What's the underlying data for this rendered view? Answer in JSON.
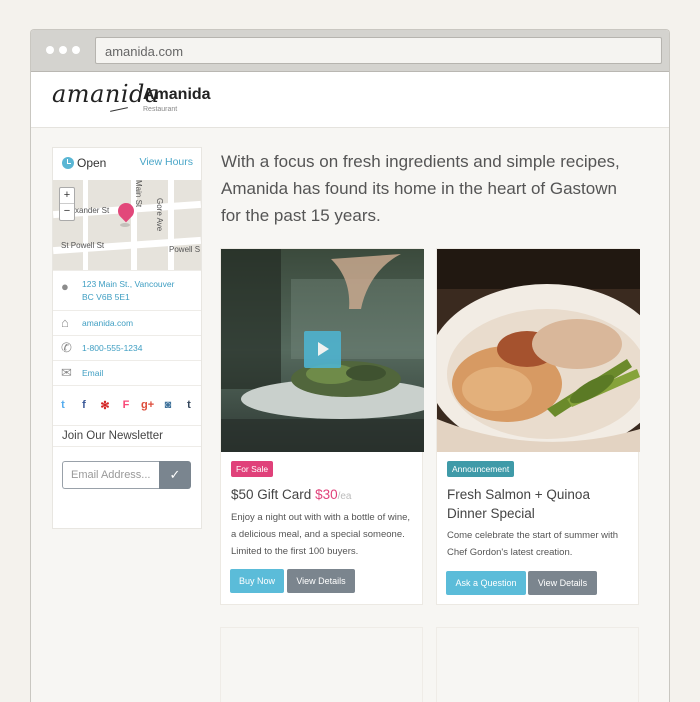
{
  "browser": {
    "url": "amanida.com"
  },
  "header": {
    "logo_text": "amanida",
    "name": "Amanida",
    "subtitle": "Restaurant"
  },
  "sidebar": {
    "status": "Open",
    "view_hours": "View Hours",
    "map": {
      "streets": [
        "xander St",
        "St Powell St",
        "Powell S",
        "Gore Ave",
        "Main St"
      ],
      "zoom_in": "+",
      "zoom_out": "−"
    },
    "address_line1": "123 Main St., Vancouver",
    "address_line2": "BC V6B 5E1",
    "website": "amanida.com",
    "phone": "1-800-555-1234",
    "email": "Email",
    "social": [
      {
        "name": "twitter-icon",
        "glyph": "t",
        "color": "#55acee"
      },
      {
        "name": "facebook-icon",
        "glyph": "f",
        "color": "#3b5998"
      },
      {
        "name": "yelp-icon",
        "glyph": "✻",
        "color": "#d32323"
      },
      {
        "name": "foursquare-icon",
        "glyph": "F",
        "color": "#f94877"
      },
      {
        "name": "googleplus-icon",
        "glyph": "g+",
        "color": "#dd4b39"
      },
      {
        "name": "instagram-icon",
        "glyph": "◙",
        "color": "#3f729b"
      },
      {
        "name": "tumblr-icon",
        "glyph": "t",
        "color": "#35465c"
      }
    ],
    "newsletter_title": "Join Our Newsletter",
    "email_placeholder": "Email Address...",
    "submit_glyph": "✓"
  },
  "intro": "With a focus on fresh ingredients and simple recipes, Amanida has found its home in the heart of Gastown for the past 15 years.",
  "cards": [
    {
      "badge": "For Sale",
      "badge_color": "#e0417a",
      "title": "$50 Gift Card",
      "price": "$30",
      "price_unit": "/ea",
      "desc": "Enjoy a night out with with a bottle of wine, a delicious meal, and a special someone. Limited to the first 100 buyers.",
      "primary_btn": "Buy Now",
      "secondary_btn": "View Details"
    },
    {
      "badge": "Announcement",
      "badge_color": "#3f9aa8",
      "title": "Fresh Salmon + Quinoa Dinner Special",
      "desc": "Come celebrate the start of summer with Chef Gordon's latest creation.",
      "primary_btn": "Ask a Question",
      "secondary_btn": "View Details"
    }
  ]
}
